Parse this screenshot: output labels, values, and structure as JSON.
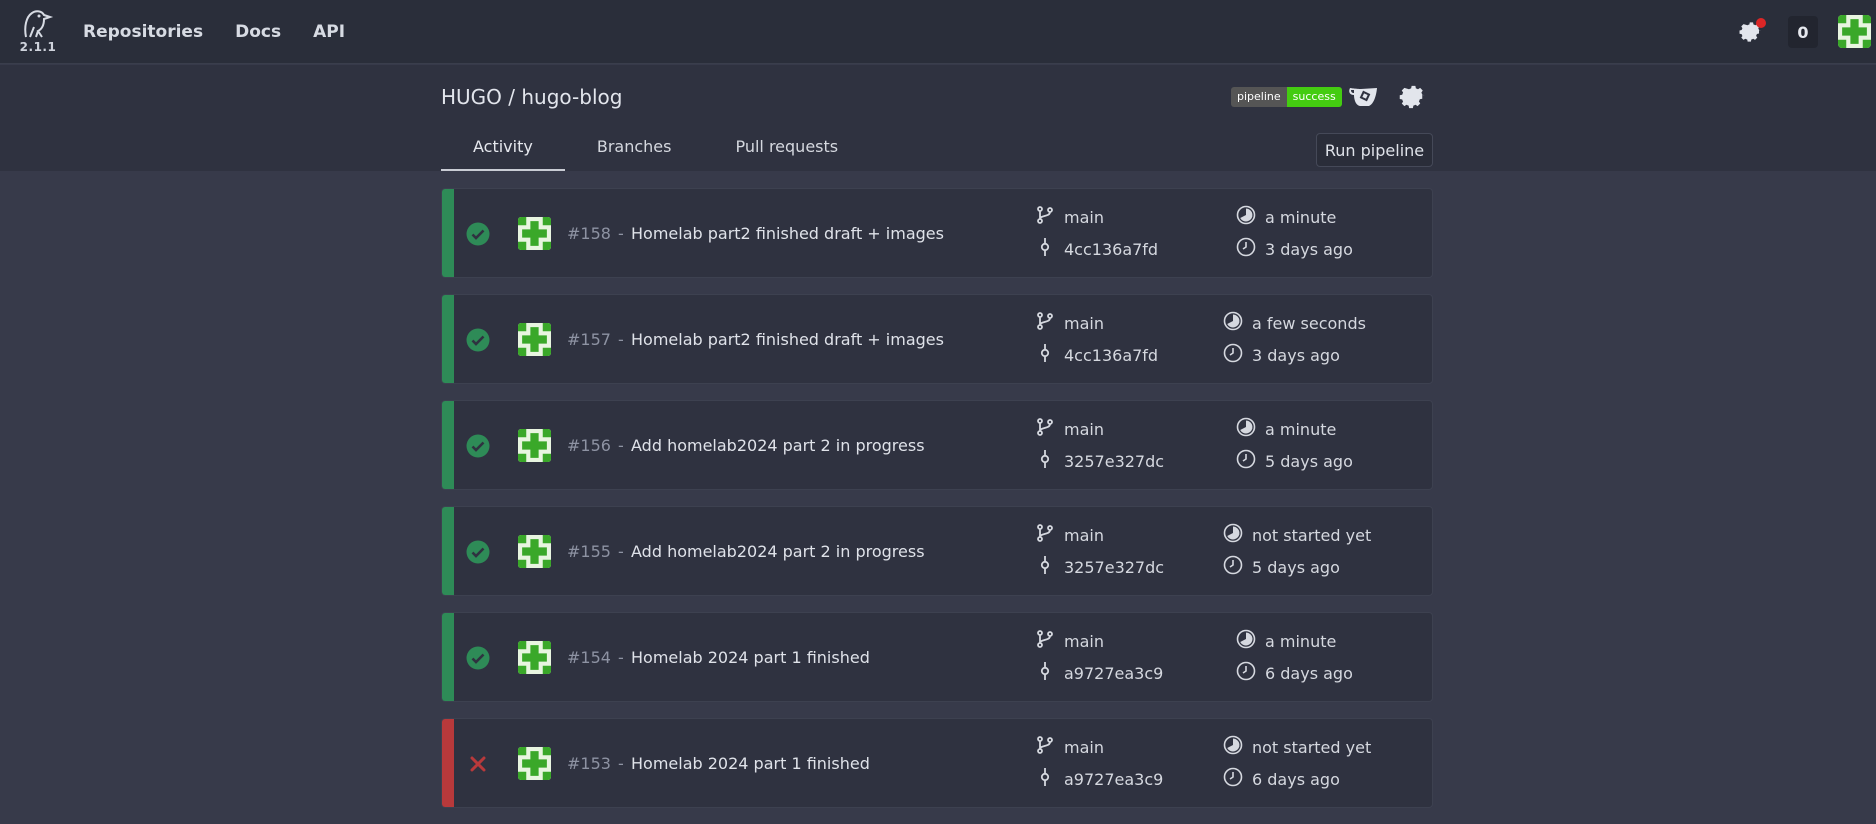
{
  "nav": {
    "version": "2.1.1",
    "links": [
      "Repositories",
      "Docs",
      "API"
    ],
    "counter": "0"
  },
  "repo": {
    "title": "HUGO / hugo-blog",
    "badge_left": "pipeline",
    "badge_right": "success",
    "badge_color": "#44cc11",
    "tabs": [
      "Activity",
      "Branches",
      "Pull requests"
    ],
    "active_tab": "Activity",
    "run_button": "Run pipeline"
  },
  "colors": {
    "success": "#2e8b57",
    "failure": "#b8393b"
  },
  "pipelines": [
    {
      "number": "#158",
      "message": "Homelab part2 finished draft + images",
      "status": "success",
      "branch": "main",
      "commit": "4cc136a7fd",
      "duration": "a minute",
      "created": "3 days ago"
    },
    {
      "number": "#157",
      "message": "Homelab part2 finished draft + images",
      "status": "success",
      "branch": "main",
      "commit": "4cc136a7fd",
      "duration": "a few seconds",
      "created": "3 days ago"
    },
    {
      "number": "#156",
      "message": "Add homelab2024 part 2 in progress",
      "status": "success",
      "branch": "main",
      "commit": "3257e327dc",
      "duration": "a minute",
      "created": "5 days ago"
    },
    {
      "number": "#155",
      "message": "Add homelab2024 part 2 in progress",
      "status": "success",
      "branch": "main",
      "commit": "3257e327dc",
      "duration": "not started yet",
      "created": "5 days ago"
    },
    {
      "number": "#154",
      "message": "Homelab 2024 part 1 finished",
      "status": "success",
      "branch": "main",
      "commit": "a9727ea3c9",
      "duration": "a minute",
      "created": "6 days ago"
    },
    {
      "number": "#153",
      "message": "Homelab 2024 part 1 finished",
      "status": "failure",
      "branch": "main",
      "commit": "a9727ea3c9",
      "duration": "not started yet",
      "created": "6 days ago"
    }
  ]
}
